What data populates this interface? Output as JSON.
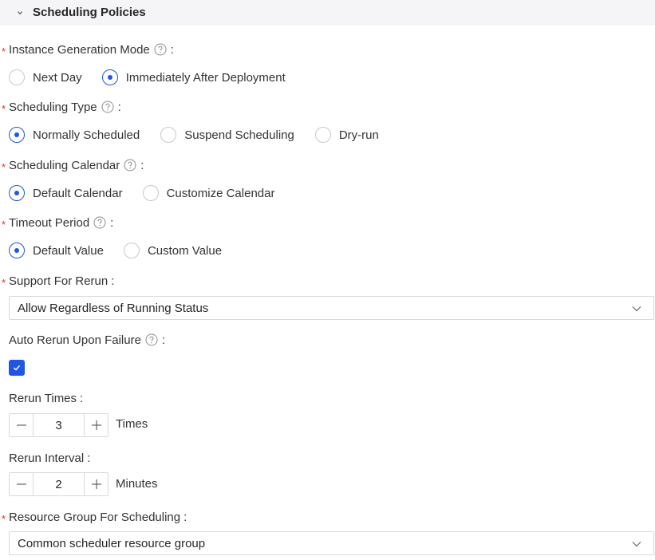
{
  "section": {
    "title": "Scheduling Policies"
  },
  "instance_generation": {
    "label": "Instance Generation Mode",
    "options": [
      "Next Day",
      "Immediately After Deployment"
    ],
    "selected": "Immediately After Deployment"
  },
  "scheduling_type": {
    "label": "Scheduling Type",
    "options": [
      "Normally Scheduled",
      "Suspend Scheduling",
      "Dry-run"
    ],
    "selected": "Normally Scheduled"
  },
  "scheduling_calendar": {
    "label": "Scheduling Calendar",
    "options": [
      "Default Calendar",
      "Customize Calendar"
    ],
    "selected": "Default Calendar"
  },
  "timeout_period": {
    "label": "Timeout Period",
    "options": [
      "Default Value",
      "Custom Value"
    ],
    "selected": "Default Value"
  },
  "support_rerun": {
    "label": "Support For Rerun",
    "value": "Allow Regardless of Running Status"
  },
  "auto_rerun": {
    "label": "Auto Rerun Upon Failure",
    "checked": true
  },
  "rerun_times": {
    "label": "Rerun Times",
    "value": "3",
    "unit": "Times"
  },
  "rerun_interval": {
    "label": "Rerun Interval",
    "value": "2",
    "unit": "Minutes"
  },
  "resource_group": {
    "label": "Resource Group For Scheduling",
    "value": "Common scheduler resource group"
  },
  "colon": ":",
  "asterisk": "*",
  "colors": {
    "accent": "#1f56e6",
    "required": "#e0301e"
  }
}
